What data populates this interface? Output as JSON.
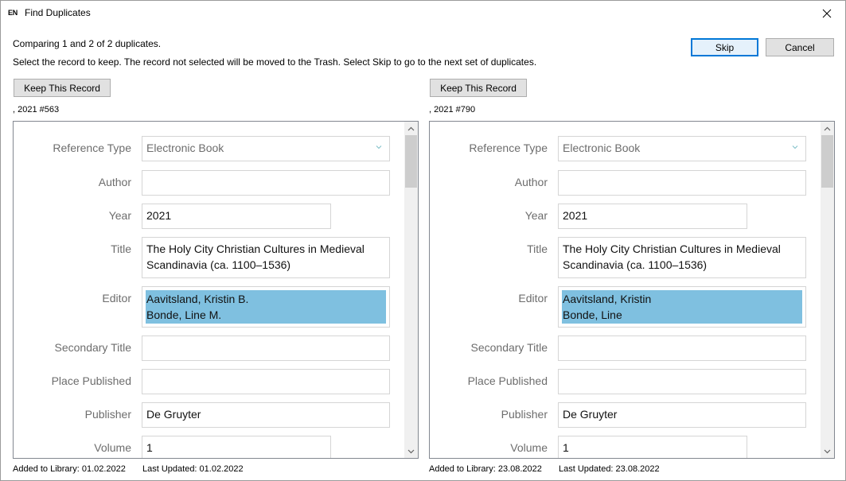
{
  "window": {
    "icon_text": "EN",
    "title": "Find Duplicates"
  },
  "header": {
    "comparing_text": "Comparing 1 and 2 of 2 duplicates.",
    "instructions_text": "Select the record to keep. The record not selected will be moved to the Trash. Select Skip to go to the next set of duplicates.",
    "skip_label": "Skip",
    "cancel_label": "Cancel"
  },
  "records": [
    {
      "keep_label": "Keep This Record",
      "record_id": ", 2021 #563",
      "fields": {
        "reference_type_label": "Reference Type",
        "reference_type_value": "Electronic Book",
        "author_label": "Author",
        "author_value": "",
        "year_label": "Year",
        "year_value": "2021",
        "title_label": "Title",
        "title_line1": "The Holy City Christian Cultures in Medieval",
        "title_line2": "Scandinavia (ca. 1100–1536)",
        "editor_label": "Editor",
        "editor_line1": "Aavitsland, Kristin B.",
        "editor_line2": "Bonde, Line M.",
        "secondary_title_label": "Secondary Title",
        "secondary_title_value": "",
        "place_published_label": "Place Published",
        "place_published_value": "",
        "publisher_label": "Publisher",
        "publisher_value": "De Gruyter",
        "volume_label": "Volume",
        "volume_value": "1"
      },
      "added_text": "Added to Library: 01.02.2022",
      "updated_text": "Last Updated: 01.02.2022"
    },
    {
      "keep_label": "Keep This Record",
      "record_id": ", 2021 #790",
      "fields": {
        "reference_type_label": "Reference Type",
        "reference_type_value": "Electronic Book",
        "author_label": "Author",
        "author_value": "",
        "year_label": "Year",
        "year_value": "2021",
        "title_label": "Title",
        "title_line1": "The Holy City Christian Cultures in Medieval",
        "title_line2": "Scandinavia (ca. 1100–1536)",
        "editor_label": "Editor",
        "editor_line1": "Aavitsland, Kristin",
        "editor_line2": "Bonde, Line",
        "secondary_title_label": "Secondary Title",
        "secondary_title_value": "",
        "place_published_label": "Place Published",
        "place_published_value": "",
        "publisher_label": "Publisher",
        "publisher_value": "De Gruyter",
        "volume_label": "Volume",
        "volume_value": "1"
      },
      "added_text": "Added to Library: 23.08.2022",
      "updated_text": "Last Updated: 23.08.2022"
    }
  ],
  "colors": {
    "highlight": "#7fc0e0",
    "default_button_border": "#0078d7",
    "label_gray": "#6d6d6d"
  },
  "icons": [
    "close-icon",
    "chevron-down-icon",
    "scroll-up-icon",
    "scroll-down-icon"
  ]
}
